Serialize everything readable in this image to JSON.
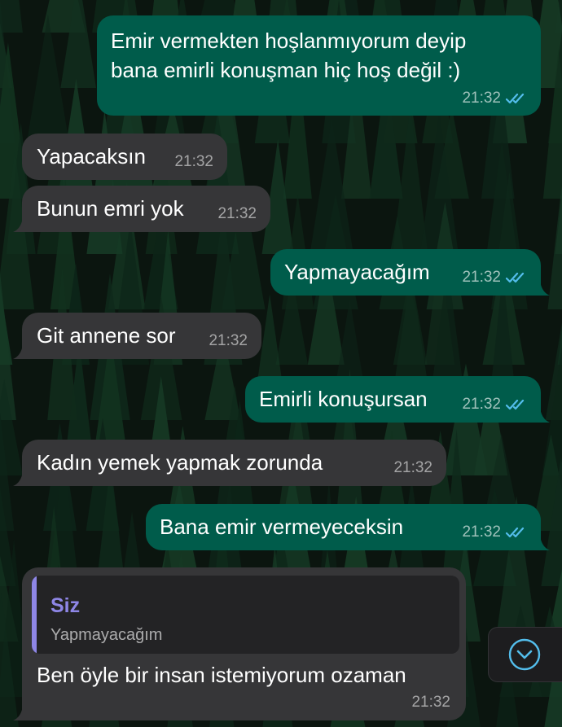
{
  "theme": {
    "outgoing_bubble": "#005c4b",
    "incoming_bubble": "#363638",
    "read_tick_color": "#53bdeb",
    "quote_author_color": "#8e86e6"
  },
  "messages": [
    {
      "direction": "outgoing",
      "text": "Emir vermekten hoşlanmıyorum deyip\nbana emirli konuşman hiç hoş değil :)",
      "time": "21:32",
      "status": "read"
    },
    {
      "direction": "incoming",
      "text": "Yapacaksın",
      "time": "21:32"
    },
    {
      "direction": "incoming",
      "text": "Bunun emri yok",
      "time": "21:32"
    },
    {
      "direction": "outgoing",
      "text": "Yapmayacağım",
      "time": "21:32",
      "status": "read"
    },
    {
      "direction": "incoming",
      "text": "Git annene sor",
      "time": "21:32"
    },
    {
      "direction": "outgoing",
      "text": "Emirli konuşursan",
      "time": "21:32",
      "status": "read"
    },
    {
      "direction": "incoming",
      "text": "Kadın yemek yapmak zorunda",
      "time": "21:32"
    },
    {
      "direction": "outgoing",
      "text": "Bana emir vermeyeceksin",
      "time": "21:32",
      "status": "read"
    },
    {
      "direction": "incoming",
      "text": "Ben öyle bir insan istemiyorum ozaman",
      "time": "21:32",
      "reply_to": {
        "author": "Siz",
        "text": "Yapmayacağım"
      }
    }
  ],
  "scroll_button": {
    "icon": "chevron-down-circle-icon"
  },
  "wallpaper": {
    "subject": "pine-forest",
    "tree_color": "#123322"
  }
}
